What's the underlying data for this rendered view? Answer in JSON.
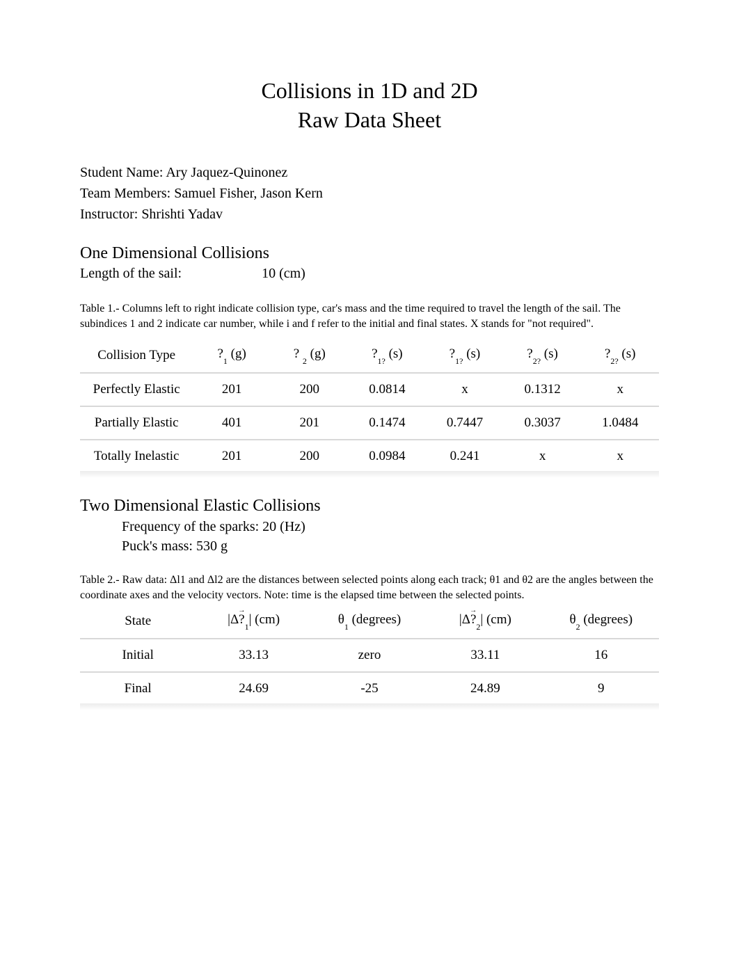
{
  "title": {
    "line1": "Collisions in 1D and 2D",
    "line2": "Raw Data Sheet"
  },
  "info": {
    "student_label": "Student Name: ",
    "student_value": "Ary Jaquez-Quinonez",
    "team_label": "Team Members: ",
    "team_value": "Samuel Fisher, Jason Kern",
    "instructor_label": "Instructor: ",
    "instructor_value": "Shrishti Yadav"
  },
  "section1": {
    "heading": "One Dimensional Collisions",
    "length_label": "Length of the sail:",
    "length_value": "10 (cm)",
    "caption": "Table 1.- Columns left to right indicate collision type, car's mass and the time required to travel the length of the sail. The subindices 1 and 2 indicate car number, while i and f refer to the initial and final states. X stands for \"not required\".",
    "headers": {
      "c0": "Collision Type",
      "c1_sym": "?",
      "c1_sub": "1",
      "c1_unit": " (g)",
      "c2_sym": "? ",
      "c2_sub": "2",
      "c2_unit": " (g)",
      "c3_sym": "?",
      "c3_sub": "1?",
      "c3_unit": " (s)",
      "c4_sym": "?",
      "c4_sub": "1?",
      "c4_unit": " (s)",
      "c5_sym": "?",
      "c5_sub": "2?",
      "c5_unit": " (s)",
      "c6_sym": "?",
      "c6_sub": "2?",
      "c6_unit": " (s)"
    },
    "rows": [
      {
        "type": "Perfectly Elastic",
        "m1": "201",
        "m2": "200",
        "t1i": "0.0814",
        "t1f": "x",
        "t2i": "0.1312",
        "t2f": "x"
      },
      {
        "type": "Partially Elastic",
        "m1": "401",
        "m2": "201",
        "t1i": "0.1474",
        "t1f": "0.7447",
        "t2i": "0.3037",
        "t2f": "1.0484"
      },
      {
        "type": "Totally Inelastic",
        "m1": "201",
        "m2": "200",
        "t1i": "0.0984",
        "t1f": "0.241",
        "t2i": "x",
        "t2f": "x"
      }
    ]
  },
  "section2": {
    "heading": "Two Dimensional Elastic Collisions",
    "freq_line": "Frequency of the sparks: 20 (Hz)",
    "mass_line": "Puck's mass: 530 g",
    "caption": "Table 2.- Raw data: Δl1 and Δl2 are the distances between selected points along each track; θ1 and θ2 are the angles between the coordinate axes and the velocity vectors. Note: time is the elapsed time between the selected points.",
    "headers": {
      "c0": "State",
      "c1_pre": "|Δ",
      "c1_sym": "?",
      "c1_sub": "1",
      "c1_post": "| (cm)",
      "c2_sym": "θ",
      "c2_sub": "1",
      "c2_unit": " (degrees)",
      "c3_pre": "|Δ",
      "c3_sym": "?",
      "c3_sub": "2",
      "c3_post": "| (cm)",
      "c4_sym": "θ",
      "c4_sub": "2",
      "c4_unit": " (degrees)"
    },
    "rows": [
      {
        "state": "Initial",
        "dl1": "33.13",
        "th1": "zero",
        "dl2": "33.11",
        "th2": "16"
      },
      {
        "state": "Final",
        "dl1": "24.69",
        "th1": "-25",
        "dl2": "24.89",
        "th2": "9"
      }
    ]
  }
}
